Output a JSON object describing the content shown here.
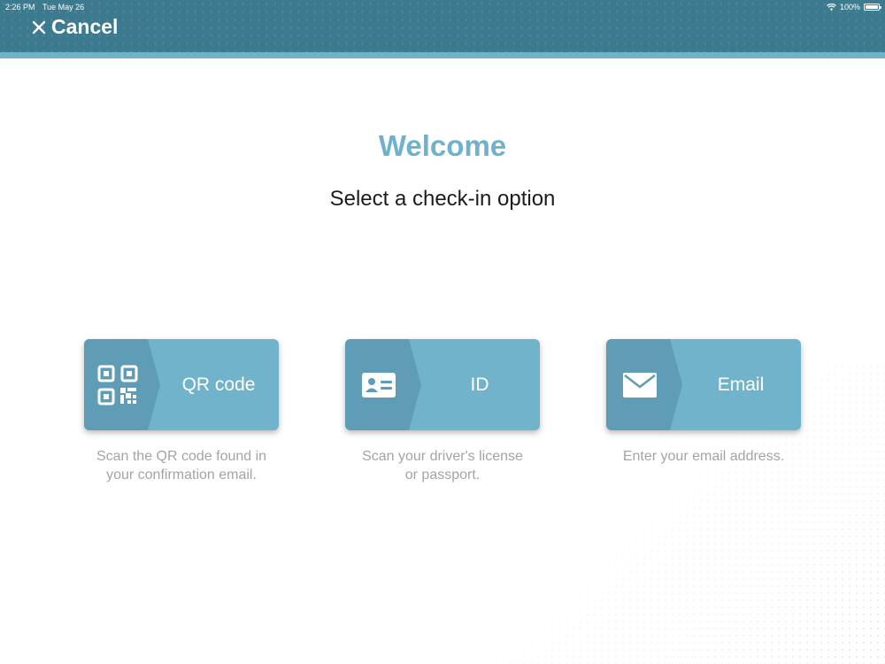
{
  "status_bar": {
    "time": "2:26 PM",
    "date": "Tue May 26",
    "battery": "100%"
  },
  "header": {
    "cancel_label": "Cancel",
    "background_color": "#3c7a90",
    "strip_color": "#6fb3cb"
  },
  "main": {
    "title": "Welcome",
    "subtitle": "Select a check-in option",
    "title_color": "#6fb2cb"
  },
  "options": [
    {
      "label": "QR code",
      "icon": "qr-code-icon",
      "line1": "Scan the QR code found in",
      "line2": "your confirmation email."
    },
    {
      "label": "ID",
      "icon": "id-card-icon",
      "line1": "Scan your driver's license",
      "line2": "or passport."
    },
    {
      "label": "Email",
      "icon": "envelope-icon",
      "line1": "Enter your email address.",
      "line2": ""
    }
  ],
  "colors": {
    "card": "#71b3cb",
    "card_icon_area": "#5e9db5",
    "description_text": "#a4a4a4"
  }
}
